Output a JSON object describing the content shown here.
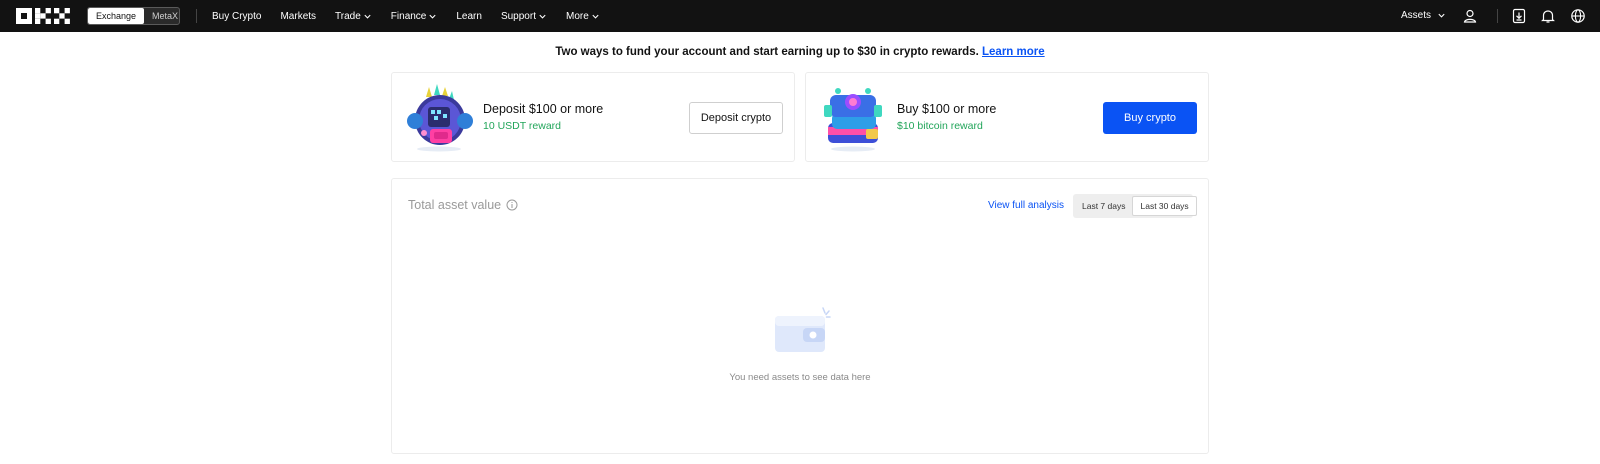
{
  "nav": {
    "brand": "OKX",
    "switch": [
      "Exchange",
      "MetaX"
    ],
    "items": [
      {
        "label": "Buy Crypto",
        "dropdown": false
      },
      {
        "label": "Markets",
        "dropdown": false
      },
      {
        "label": "Trade",
        "dropdown": true
      },
      {
        "label": "Finance",
        "dropdown": true
      },
      {
        "label": "Learn",
        "dropdown": false
      },
      {
        "label": "Support",
        "dropdown": true
      },
      {
        "label": "More",
        "dropdown": true
      }
    ],
    "assets_label": "Assets",
    "icons": [
      "user-icon",
      "download-icon",
      "bell-icon",
      "globe-icon"
    ]
  },
  "banner": {
    "text": "Two ways to fund your account and start earning up to $30 in crypto rewards.",
    "link": "Learn more"
  },
  "cards": {
    "deposit": {
      "title": "Deposit $100 or more",
      "reward": "10 USDT reward",
      "button": "Deposit crypto"
    },
    "buy": {
      "title": "Buy $100 or more",
      "reward": "$10 bitcoin reward",
      "button": "Buy crypto"
    }
  },
  "assets": {
    "title": "Total asset value",
    "view_link": "View full analysis",
    "ranges": [
      "Last 7 days",
      "Last 30 days"
    ],
    "selected_range": "Last 30 days",
    "empty_message": "You need assets to see data here"
  },
  "colors": {
    "accent": "#0a53f4",
    "reward_green": "#22a55a",
    "topbar": "#121212"
  }
}
